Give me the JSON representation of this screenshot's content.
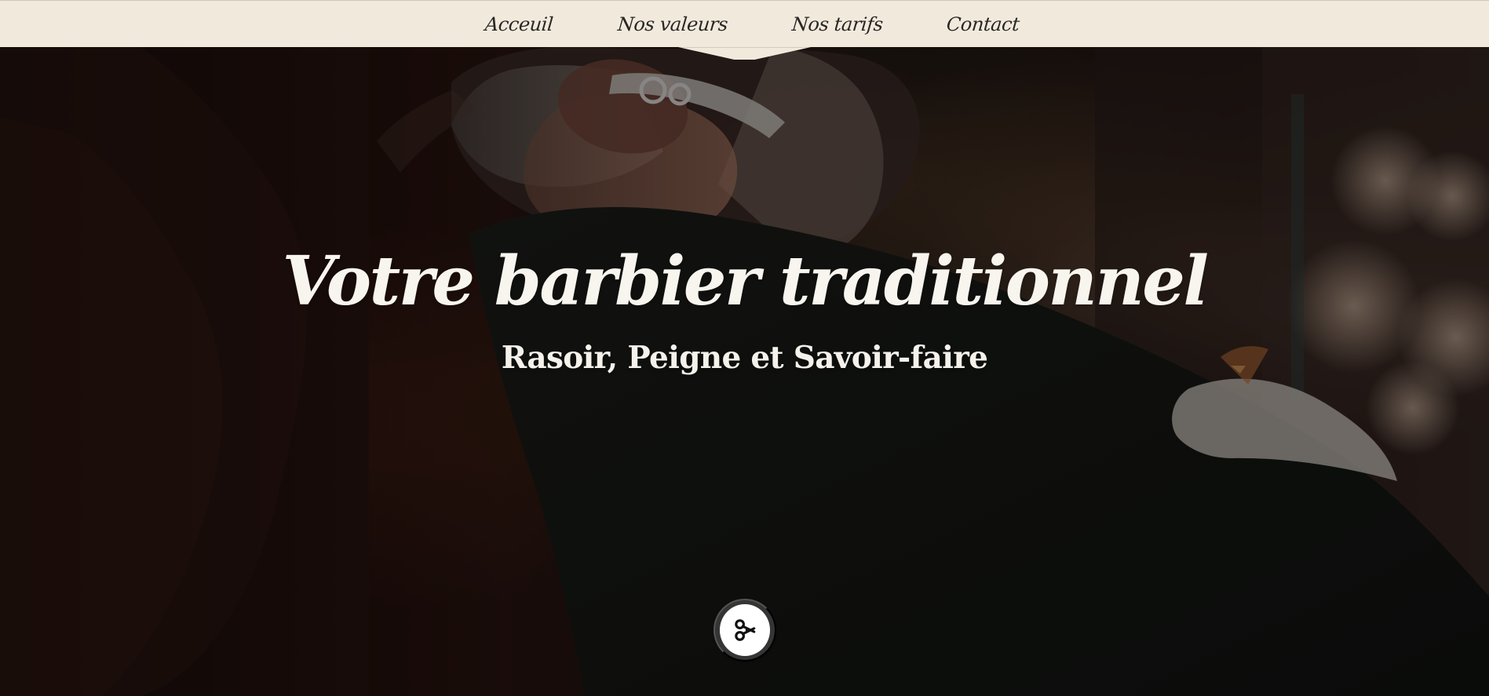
{
  "colors": {
    "nav_bg": "#f1eadc",
    "nav_text": "#292626",
    "hero_text": "#f8f5ef",
    "button_outer": "#3c3c3c",
    "button_inner": "#ffffff"
  },
  "nav": {
    "items": [
      {
        "label": "Acceuil"
      },
      {
        "label": "Nos valeurs"
      },
      {
        "label": "Nos tarifs"
      },
      {
        "label": "Contact"
      }
    ]
  },
  "hero": {
    "title": "Votre barbier traditionnel",
    "subtitle": "Rasoir, Peigne et Savoir-faire"
  },
  "scroll_button": {
    "icon": "scissors-icon"
  }
}
